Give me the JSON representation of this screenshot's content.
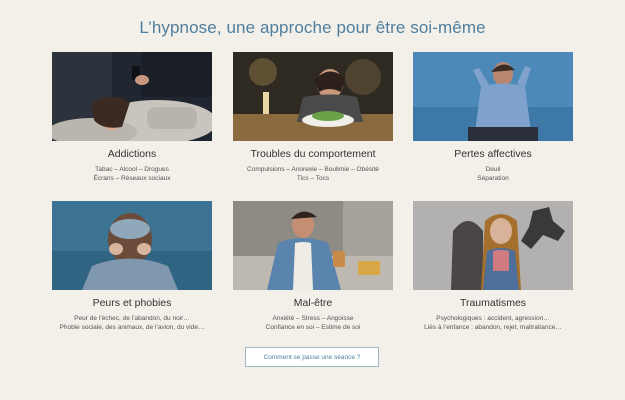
{
  "page": {
    "title": "L’hypnose, une approche pour être soi-même"
  },
  "cards": [
    {
      "title": "Addictions",
      "line1": "Tabac – Alcool – Drogues",
      "line2": "Écrans – Réseaux sociaux"
    },
    {
      "title": "Troubles du comportement",
      "line1": "Compulsions – Anorexie – Boulimie – Obésité",
      "line2": "Tics – Tocs"
    },
    {
      "title": "Pertes affectives",
      "line1": "Deuil",
      "line2": "Séparation"
    },
    {
      "title": "Peurs et phobies",
      "line1": "Peur de l’échec, de l’abandon, du noir…",
      "line2": "Phobie sociale, des animaux, de l’avion, du vide…"
    },
    {
      "title": "Mal-être",
      "line1": "Anxiété – Stress – Angoisse",
      "line2": "Confiance en soi – Estime de soi"
    },
    {
      "title": "Traumatismes",
      "line1": "Psychologiques : accident, agression…",
      "line2": "Liés à l’enfance : abandon, rejet, maltraitance…"
    }
  ],
  "cta": {
    "label": "Comment se passe une séance ?"
  }
}
